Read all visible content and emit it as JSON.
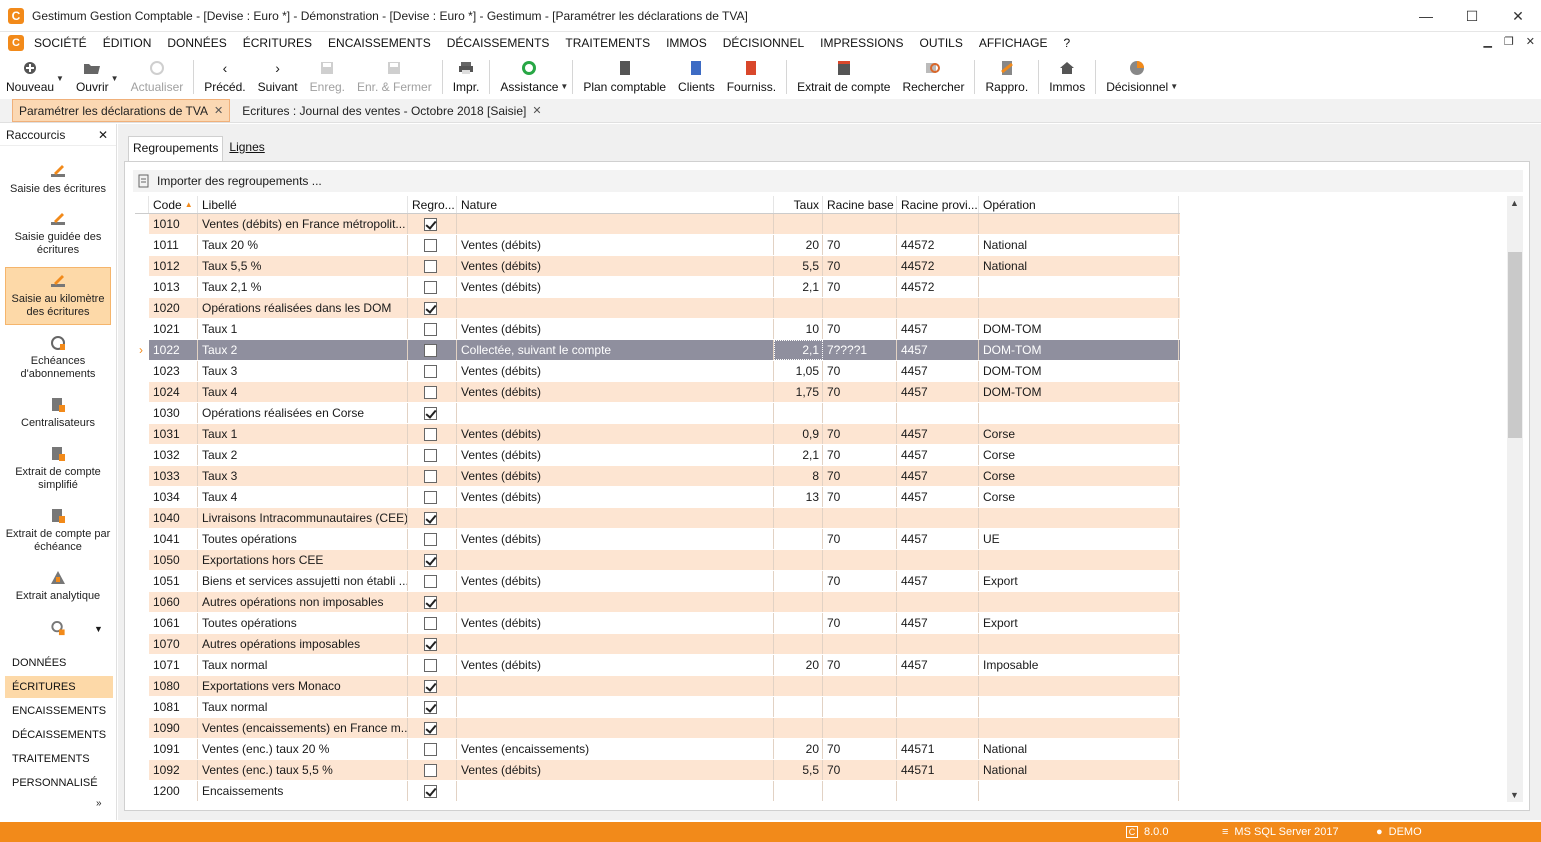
{
  "window": {
    "title": "Gestimum Gestion Comptable - [Devise : Euro *] - Démonstration - [Devise : Euro *] - Gestimum - [Paramétrer les déclarations de TVA]",
    "minimize": "—",
    "maximize": "☐",
    "close": "✕"
  },
  "menu": [
    "SOCIÉTÉ",
    "ÉDITION",
    "DONNÉES",
    "ÉCRITURES",
    "ENCAISSEMENTS",
    "DÉCAISSEMENTS",
    "TRAITEMENTS",
    "IMMOS",
    "DÉCISIONNEL",
    "IMPRESSIONS",
    "OUTILS",
    "AFFICHAGE",
    "?"
  ],
  "toolbar": {
    "nouveau": "Nouveau",
    "ouvrir": "Ouvrir",
    "actualiser": "Actualiser",
    "preced": "Précéd.",
    "suivant": "Suivant",
    "enreg": "Enreg.",
    "enr_fermer": "Enr. & Fermer",
    "impr": "Impr.",
    "assistance": "Assistance",
    "plan": "Plan comptable",
    "clients": "Clients",
    "fourniss": "Fourniss.",
    "extrait": "Extrait de compte",
    "rechercher": "Rechercher",
    "rappro": "Rappro.",
    "immos": "Immos",
    "decisionnel": "Décisionnel"
  },
  "doc_tabs": [
    "Paramétrer les déclarations de TVA",
    "Ecritures : Journal des ventes - Octobre 2018 [Saisie]"
  ],
  "sidebar": {
    "header": "Raccourcis",
    "items": [
      "Saisie des écritures",
      "Saisie guidée des écritures",
      "Saisie au kilomètre des écritures",
      "Echéances d'abonnements",
      "Centralisateurs",
      "Extrait de compte simplifié",
      "Extrait de compte par échéance",
      "Extrait analytique"
    ],
    "sections": [
      "DONNÉES",
      "ÉCRITURES",
      "ENCAISSEMENTS",
      "DÉCAISSEMENTS",
      "TRAITEMENTS",
      "PERSONNALISÉ"
    ]
  },
  "subtabs": [
    "Regroupements",
    "Lignes"
  ],
  "import_label": "Importer des regroupements ...",
  "columns": {
    "code": "Code",
    "libelle": "Libellé",
    "regro": "Regro...",
    "nature": "Nature",
    "taux": "Taux",
    "racine_base": "Racine base",
    "racine_provi": "Racine provi...",
    "operation": "Opération"
  },
  "rows": [
    {
      "code": "1010",
      "libelle": "Ventes (débits) en France métropolit...",
      "regro": true,
      "nature": "",
      "taux": "",
      "base": "",
      "provi": "",
      "op": ""
    },
    {
      "code": "1011",
      "libelle": "Taux  20 %",
      "regro": false,
      "nature": "Ventes (débits)",
      "taux": "20",
      "base": "70",
      "provi": "44572",
      "op": "National"
    },
    {
      "code": "1012",
      "libelle": "Taux 5,5 %",
      "regro": false,
      "nature": "Ventes (débits)",
      "taux": "5,5",
      "base": "70",
      "provi": "44572",
      "op": "National"
    },
    {
      "code": "1013",
      "libelle": "Taux 2,1 %",
      "regro": false,
      "nature": "Ventes (débits)",
      "taux": "2,1",
      "base": "70",
      "provi": "44572",
      "op": ""
    },
    {
      "code": "1020",
      "libelle": "Opérations réalisées dans les DOM",
      "regro": true,
      "nature": "",
      "taux": "",
      "base": "",
      "provi": "",
      "op": ""
    },
    {
      "code": "1021",
      "libelle": "Taux 1",
      "regro": false,
      "nature": "Ventes (débits)",
      "taux": "10",
      "base": "70",
      "provi": "4457",
      "op": "DOM-TOM"
    },
    {
      "code": "1022",
      "libelle": "Taux 2",
      "regro": false,
      "nature": "Collectée, suivant le compte",
      "taux": "2,1",
      "base": "7????1",
      "provi": "4457",
      "op": "DOM-TOM",
      "selected": true
    },
    {
      "code": "1023",
      "libelle": "Taux 3",
      "regro": false,
      "nature": "Ventes (débits)",
      "taux": "1,05",
      "base": "70",
      "provi": "4457",
      "op": "DOM-TOM"
    },
    {
      "code": "1024",
      "libelle": "Taux 4",
      "regro": false,
      "nature": "Ventes (débits)",
      "taux": "1,75",
      "base": "70",
      "provi": "4457",
      "op": "DOM-TOM"
    },
    {
      "code": "1030",
      "libelle": "Opérations réalisées en Corse",
      "regro": true,
      "nature": "",
      "taux": "",
      "base": "",
      "provi": "",
      "op": ""
    },
    {
      "code": "1031",
      "libelle": "Taux 1",
      "regro": false,
      "nature": "Ventes (débits)",
      "taux": "0,9",
      "base": "70",
      "provi": "4457",
      "op": "Corse"
    },
    {
      "code": "1032",
      "libelle": "Taux 2",
      "regro": false,
      "nature": "Ventes (débits)",
      "taux": "2,1",
      "base": "70",
      "provi": "4457",
      "op": "Corse"
    },
    {
      "code": "1033",
      "libelle": "Taux 3",
      "regro": false,
      "nature": "Ventes (débits)",
      "taux": "8",
      "base": "70",
      "provi": "4457",
      "op": "Corse"
    },
    {
      "code": "1034",
      "libelle": "Taux 4",
      "regro": false,
      "nature": "Ventes (débits)",
      "taux": "13",
      "base": "70",
      "provi": "4457",
      "op": "Corse"
    },
    {
      "code": "1040",
      "libelle": "Livraisons Intracommunautaires (CEE)",
      "regro": true,
      "nature": "",
      "taux": "",
      "base": "",
      "provi": "",
      "op": ""
    },
    {
      "code": "1041",
      "libelle": "Toutes opérations",
      "regro": false,
      "nature": "Ventes (débits)",
      "taux": "",
      "base": "70",
      "provi": "4457",
      "op": "UE"
    },
    {
      "code": "1050",
      "libelle": "Exportations hors CEE",
      "regro": true,
      "nature": "",
      "taux": "",
      "base": "",
      "provi": "",
      "op": ""
    },
    {
      "code": "1051",
      "libelle": "Biens et services assujetti non établi ...",
      "regro": false,
      "nature": "Ventes (débits)",
      "taux": "",
      "base": "70",
      "provi": "4457",
      "op": "Export"
    },
    {
      "code": "1060",
      "libelle": "Autres opérations non imposables",
      "regro": true,
      "nature": "",
      "taux": "",
      "base": "",
      "provi": "",
      "op": ""
    },
    {
      "code": "1061",
      "libelle": "Toutes opérations",
      "regro": false,
      "nature": "Ventes (débits)",
      "taux": "",
      "base": "70",
      "provi": "4457",
      "op": "Export"
    },
    {
      "code": "1070",
      "libelle": "Autres opérations imposables",
      "regro": true,
      "nature": "",
      "taux": "",
      "base": "",
      "provi": "",
      "op": ""
    },
    {
      "code": "1071",
      "libelle": "Taux normal",
      "regro": false,
      "nature": "Ventes (débits)",
      "taux": "20",
      "base": "70",
      "provi": "4457",
      "op": "Imposable"
    },
    {
      "code": "1080",
      "libelle": "Exportations vers Monaco",
      "regro": true,
      "nature": "",
      "taux": "",
      "base": "",
      "provi": "",
      "op": ""
    },
    {
      "code": "1081",
      "libelle": "Taux normal",
      "regro": true,
      "nature": "",
      "taux": "",
      "base": "",
      "provi": "",
      "op": ""
    },
    {
      "code": "1090",
      "libelle": "Ventes (encaissements) en France m...",
      "regro": true,
      "nature": "",
      "taux": "",
      "base": "",
      "provi": "",
      "op": ""
    },
    {
      "code": "1091",
      "libelle": "Ventes (enc.) taux 20 %",
      "regro": false,
      "nature": "Ventes (encaissements)",
      "taux": "20",
      "base": "70",
      "provi": "44571",
      "op": "National"
    },
    {
      "code": "1092",
      "libelle": "Ventes (enc.) taux 5,5 %",
      "regro": false,
      "nature": "Ventes (débits)",
      "taux": "5,5",
      "base": "70",
      "provi": "44571",
      "op": "National"
    },
    {
      "code": "1200",
      "libelle": "Encaissements",
      "regro": true,
      "nature": "",
      "taux": "",
      "base": "",
      "provi": "",
      "op": ""
    }
  ],
  "status": {
    "version": "8.0.0",
    "db": "MS SQL Server 2017",
    "user": "DEMO"
  },
  "colors": {
    "accent": "#f28a1a",
    "row_alt": "#fde5d2",
    "selected": "#8f8f9e"
  }
}
